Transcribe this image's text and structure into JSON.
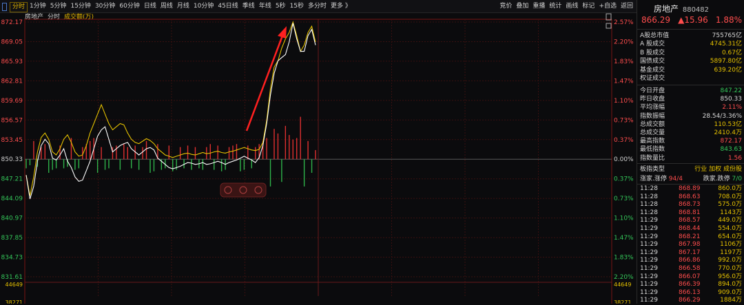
{
  "toolbar": {
    "periods": [
      "分时",
      "1分钟",
      "5分钟",
      "15分钟",
      "30分钟",
      "60分钟",
      "日线",
      "周线",
      "月线",
      "10分钟",
      "45日线",
      "季线",
      "年线",
      "5秒",
      "15秒",
      "多分时",
      "更多 》"
    ],
    "right_tools": [
      "竞价",
      "叠加",
      "重播",
      "统计",
      "画线",
      "标记",
      "+自选",
      "返回"
    ]
  },
  "legend": {
    "name": "房地产",
    "period": "分时",
    "volume": "成交额(万)"
  },
  "chart_data": {
    "type": "line",
    "left_ticks": [
      "872.17",
      "869.05",
      "865.93",
      "862.81",
      "859.69",
      "856.57",
      "853.45",
      "850.33",
      "847.21",
      "844.09",
      "840.97",
      "837.85",
      "834.73",
      "831.61"
    ],
    "right_ticks": [
      "2.57%",
      "2.20%",
      "1.83%",
      "1.47%",
      "1.10%",
      "0.73%",
      "0.37%",
      "0.00%",
      "0.37%",
      "0.73%",
      "1.10%",
      "1.47%",
      "1.83%",
      "2.20%"
    ],
    "volume_ticks": [
      "44649",
      "38271"
    ],
    "ylim": [
      831.61,
      872.17
    ],
    "base": 850.33,
    "price_series": [
      847.8,
      844.0,
      846.0,
      850.0,
      852.5,
      853.5,
      852.8,
      850.5,
      850.2,
      851.0,
      852.0,
      850.0,
      849.0,
      847.5,
      846.8,
      847.0,
      848.5,
      850.0,
      852.0,
      854.0,
      855.0,
      855.5,
      853.5,
      851.5,
      852.0,
      852.5,
      852.8,
      853.0,
      852.0,
      851.5,
      851.0,
      851.5,
      852.0,
      852.2,
      851.8,
      850.5,
      850.0,
      849.5,
      849.0,
      848.8,
      849.0,
      849.2,
      849.5,
      849.8,
      849.7,
      849.5,
      849.6,
      849.8,
      849.5,
      849.6,
      849.8,
      850.0,
      849.8,
      849.5,
      849.8,
      850.0,
      850.2,
      850.5,
      850.8,
      850.5,
      850.2,
      849.8,
      850.6,
      852.5,
      856.0,
      860.5,
      864.0,
      866.0,
      866.5,
      867.0,
      869.0,
      872.0,
      869.5,
      867.5,
      867.5,
      870.0,
      871.0,
      868.5
    ],
    "avg_series": [
      847.8,
      844.5,
      847.5,
      851.5,
      853.8,
      854.5,
      853.5,
      851.5,
      851.0,
      852.0,
      853.5,
      854.2,
      853.0,
      851.5,
      850.8,
      851.0,
      852.5,
      854.5,
      856.0,
      857.5,
      859.0,
      857.5,
      856.0,
      855.0,
      855.5,
      856.0,
      855.8,
      854.5,
      853.5,
      853.0,
      852.8,
      853.2,
      853.6,
      853.3,
      852.8,
      852.0,
      851.5,
      851.0,
      850.8,
      850.6,
      850.8,
      851.0,
      851.2,
      851.3,
      851.1,
      851.0,
      851.2,
      851.4,
      851.2,
      851.3,
      851.5,
      851.6,
      851.4,
      851.3,
      851.5,
      851.6,
      851.8,
      852.0,
      852.2,
      852.0,
      851.8,
      851.7,
      851.9,
      853.0,
      856.5,
      861.5,
      865.0,
      866.0,
      868.0,
      869.5,
      870.5,
      872.17,
      870.0,
      867.5,
      868.5,
      870.5,
      871.5,
      869.0
    ],
    "volume": [
      6,
      4,
      12,
      5,
      8,
      10,
      9,
      7,
      6,
      9,
      6,
      5,
      14,
      7,
      6,
      8,
      10,
      12,
      14,
      9,
      8,
      7,
      6,
      8,
      9,
      7,
      10,
      8,
      6,
      9,
      7,
      8,
      12,
      9,
      8,
      10,
      7,
      6,
      9,
      8,
      7,
      8,
      6,
      9,
      7,
      8,
      6,
      7,
      8,
      10,
      7,
      9,
      8,
      7,
      8,
      9,
      10,
      8,
      7,
      9,
      6,
      8,
      10,
      12,
      14,
      18,
      20,
      17,
      15,
      22,
      16,
      13,
      14,
      28,
      18,
      12,
      9,
      6
    ],
    "volume_dir": [
      "d",
      "d",
      "u",
      "d",
      "u",
      "u",
      "d",
      "d",
      "d",
      "u",
      "d",
      "d",
      "u",
      "d",
      "d",
      "u",
      "u",
      "u",
      "u",
      "d",
      "u",
      "d",
      "d",
      "u",
      "u",
      "d",
      "u",
      "u",
      "d",
      "u",
      "d",
      "u",
      "u",
      "d",
      "d",
      "u",
      "d",
      "d",
      "u",
      "d",
      "d",
      "u",
      "d",
      "u",
      "d",
      "u",
      "d",
      "d",
      "u",
      "u",
      "d",
      "u",
      "d",
      "d",
      "u",
      "u",
      "u",
      "d",
      "d",
      "u",
      "d",
      "u",
      "u",
      "u",
      "u",
      "d",
      "u",
      "u",
      "d",
      "u",
      "u",
      "u",
      "u",
      "u",
      "d",
      "u",
      "d",
      "u"
    ]
  },
  "panel": {
    "title": "房地产",
    "code": "880482",
    "price": "866.29",
    "change": "▲15.96",
    "pct": "1.88%",
    "stats1": [
      {
        "label": "A股总市值",
        "value": "755765亿",
        "color": "white"
      },
      {
        "label": "A 股成交",
        "value": "4745.31亿",
        "color": "yellow"
      },
      {
        "label": "B 股成交",
        "value": "0.67亿",
        "color": "yellow"
      },
      {
        "label": "国债成交",
        "value": "5897.80亿",
        "color": "yellow"
      },
      {
        "label": "基金成交",
        "value": "639.20亿",
        "color": "yellow"
      },
      {
        "label": "权证成交",
        "value": "",
        "color": "yellow"
      }
    ],
    "stats2": [
      {
        "label": "今日开盘",
        "value": "847.22",
        "color": "green"
      },
      {
        "label": "昨日收盘",
        "value": "850.33",
        "color": "white"
      },
      {
        "label": "平均涨幅",
        "value": "2.11%",
        "color": "red"
      },
      {
        "label": "指数振幅",
        "value": "28.54/3.36%",
        "color": "white"
      },
      {
        "label": "总成交额",
        "value": "110.53亿",
        "color": "yellow"
      },
      {
        "label": "总成交量",
        "value": "2410.4万",
        "color": "yellow"
      },
      {
        "label": "最高指数",
        "value": "872.17",
        "color": "red"
      },
      {
        "label": "最低指数",
        "value": "843.63",
        "color": "green"
      },
      {
        "label": "指数量比",
        "value": "1.56",
        "color": "red"
      }
    ],
    "board_label": "板指类型",
    "board_value": "行业 加权 成份股",
    "updown_label": "涨家.涨停",
    "updown_value": "94/4",
    "fall_label": "跌家.跌停",
    "fall_value": "7/0",
    "ticks": [
      {
        "time": "11:28",
        "price": "868.89",
        "vol": "860.0万"
      },
      {
        "time": "11:28",
        "price": "868.63",
        "vol": "708.0万"
      },
      {
        "time": "11:28",
        "price": "868.73",
        "vol": "575.0万"
      },
      {
        "time": "11:28",
        "price": "868.81",
        "vol": "1143万"
      },
      {
        "time": "11:29",
        "price": "868.57",
        "vol": "449.0万"
      },
      {
        "time": "11:29",
        "price": "868.44",
        "vol": "554.0万"
      },
      {
        "time": "11:29",
        "price": "868.21",
        "vol": "654.0万"
      },
      {
        "time": "11:29",
        "price": "867.98",
        "vol": "1106万"
      },
      {
        "time": "11:29",
        "price": "867.17",
        "vol": "1197万"
      },
      {
        "time": "11:29",
        "price": "866.86",
        "vol": "992.0万"
      },
      {
        "time": "11:29",
        "price": "866.58",
        "vol": "770.0万"
      },
      {
        "time": "11:29",
        "price": "866.07",
        "vol": "956.0万"
      },
      {
        "time": "11:29",
        "price": "866.39",
        "vol": "894.0万"
      },
      {
        "time": "11:29",
        "price": "866.13",
        "vol": "909.0万"
      },
      {
        "time": "11:29",
        "price": "866.29",
        "vol": "1884万"
      }
    ]
  }
}
